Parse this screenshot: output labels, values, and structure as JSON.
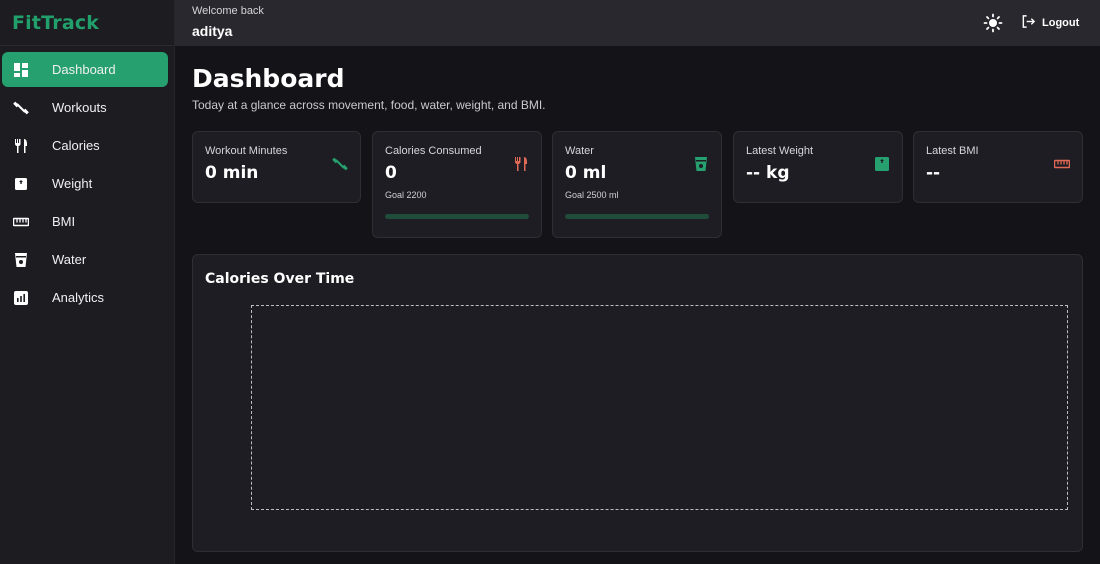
{
  "app": {
    "brand": "FitTrack"
  },
  "sidebar": {
    "items": [
      {
        "label": "Dashboard",
        "icon": "dashboard-icon",
        "active": true
      },
      {
        "label": "Workouts",
        "icon": "dumbbell-icon"
      },
      {
        "label": "Calories",
        "icon": "utensils-icon"
      },
      {
        "label": "Weight",
        "icon": "scale-icon"
      },
      {
        "label": "BMI",
        "icon": "ruler-icon"
      },
      {
        "label": "Water",
        "icon": "cup-icon"
      },
      {
        "label": "Analytics",
        "icon": "analytics-icon"
      }
    ]
  },
  "header": {
    "welcome": "Welcome back",
    "username": "aditya",
    "theme_icon": "sun-icon",
    "logout_label": "Logout"
  },
  "page": {
    "title": "Dashboard",
    "subtitle": "Today at a glance across movement, food, water, weight, and BMI."
  },
  "cards": {
    "workout": {
      "label": "Workout Minutes",
      "value": "0 min",
      "icon": "dumbbell-icon"
    },
    "calories": {
      "label": "Calories Consumed",
      "value": "0",
      "goal": "Goal 2200",
      "progress": 0,
      "icon": "utensils-icon"
    },
    "water": {
      "label": "Water",
      "value": "0 ml",
      "goal": "Goal 2500 ml",
      "progress": 0,
      "icon": "cup-icon"
    },
    "weight": {
      "label": "Latest Weight",
      "value": "-- kg",
      "icon": "scale-icon"
    },
    "bmi": {
      "label": "Latest BMI",
      "value": "--",
      "icon": "ruler-icon"
    }
  },
  "chart": {
    "title": "Calories Over Time"
  },
  "colors": {
    "accent": "#26a06e",
    "accent_dark": "#1f4d3a",
    "danger": "#e06a55",
    "background": "#131318",
    "surface": "#1d1d23"
  }
}
